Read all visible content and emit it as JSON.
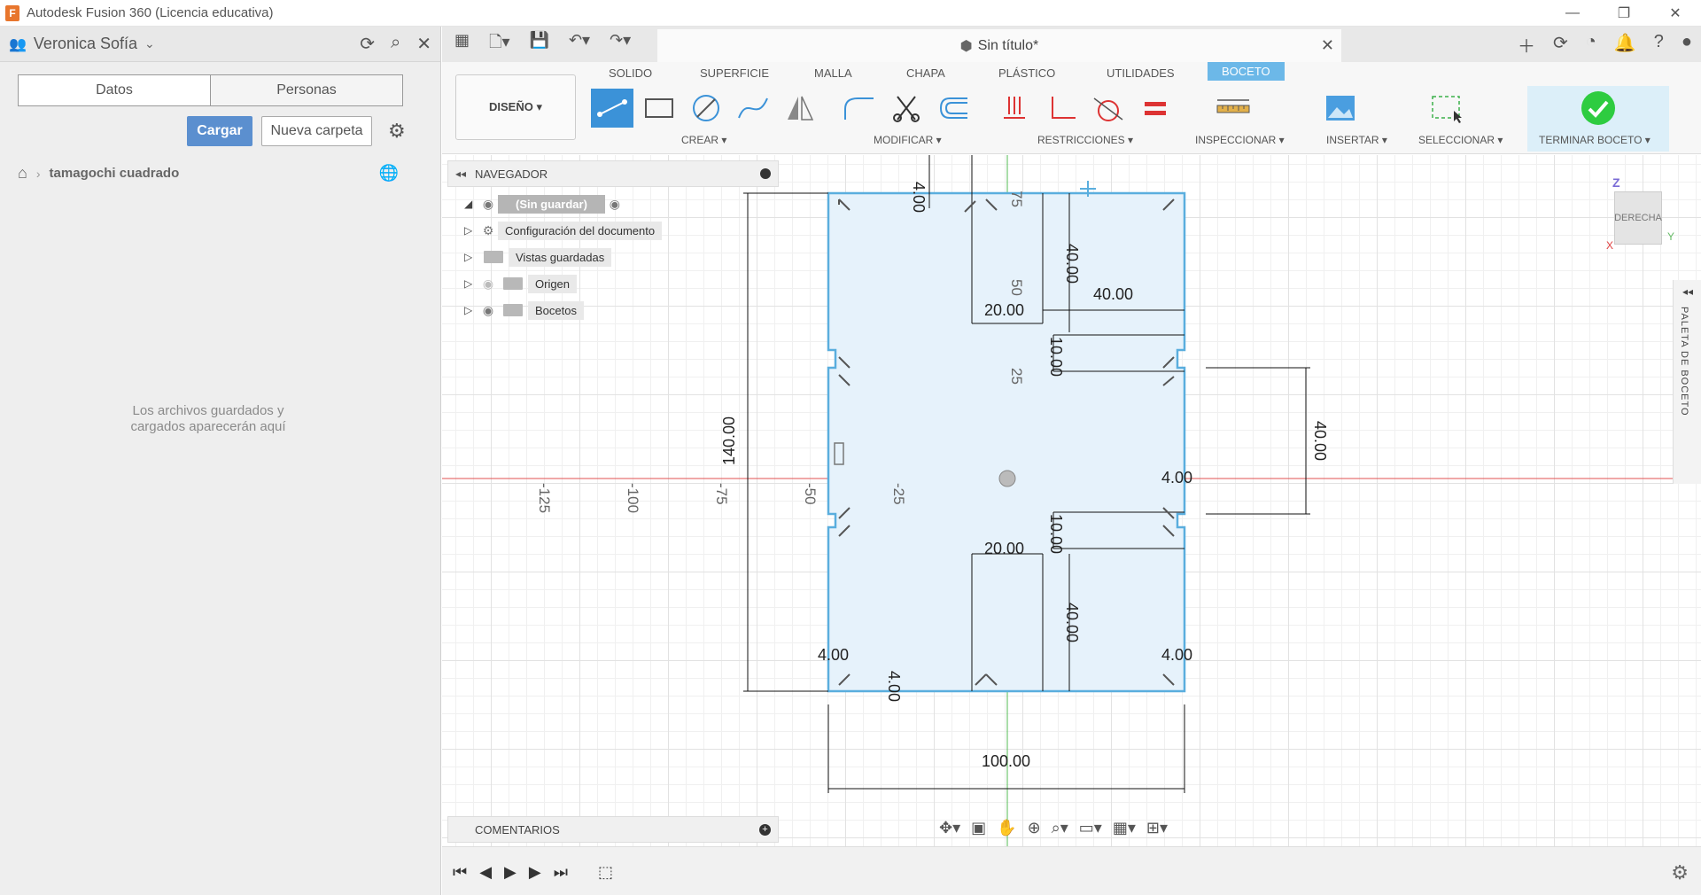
{
  "window": {
    "title": "Autodesk Fusion 360 (Licencia educativa)",
    "logo_letter": "F",
    "minimize": "—",
    "restore": "❐",
    "close": "✕"
  },
  "data_panel": {
    "user_name": "Veronica Sofía",
    "tabs": [
      "Datos",
      "Personas"
    ],
    "upload_button": "Cargar",
    "new_folder_button": "Nueva carpeta",
    "breadcrumb_folder": "tamagochi cuadrado",
    "empty_message_line1": "Los archivos guardados y",
    "empty_message_line2": "cargados aparecerán aquí"
  },
  "document": {
    "title": "Sin título*"
  },
  "ribbon": {
    "design_button": "DISEÑO ▾",
    "tabs": [
      "SOLIDO",
      "SUPERFICIE",
      "MALLA",
      "CHAPA",
      "PLÁSTICO",
      "UTILIDADES",
      "BOCETO"
    ],
    "active_tab": "BOCETO",
    "groups": {
      "crear": "CREAR ▾",
      "modificar": "MODIFICAR ▾",
      "restricciones": "RESTRICCIONES ▾",
      "inspeccionar": "INSPECCIONAR ▾",
      "insertar": "INSERTAR ▾",
      "seleccionar": "SELECCIONAR ▾",
      "terminar": "TERMINAR BOCETO ▾"
    },
    "accent_color": "#3b92d8",
    "finish_color": "#2ecc40"
  },
  "navigator": {
    "title": "NAVEGADOR",
    "root": "(Sin guardar)",
    "items": [
      "Configuración del documento",
      "Vistas guardadas",
      "Origen",
      "Bocetos"
    ]
  },
  "comments": {
    "label": "COMENTARIOS"
  },
  "viewcube": {
    "face": "DERECHA",
    "axis_z": "Z",
    "axis_x": "X",
    "axis_y": "Y"
  },
  "sketch_palette": {
    "label": "PALETA DE BOCETO"
  },
  "sketch": {
    "dimensions": [
      "40.00",
      "40.00",
      "20.00",
      "10.00",
      "140.00",
      "40.00",
      "4.00",
      "10.00",
      "20.00",
      "40.00",
      "4.00",
      "4.00",
      "100.00",
      "4.00",
      "4.00"
    ],
    "axis_ticks": [
      "-125",
      "-100",
      "-75",
      "-50",
      "-25",
      "75",
      "50",
      "25"
    ],
    "line_color": "#5aaede",
    "fill_color": "#e6f2fb",
    "x_axis_color": "#e05050",
    "y_axis_color": "#55bb55"
  }
}
